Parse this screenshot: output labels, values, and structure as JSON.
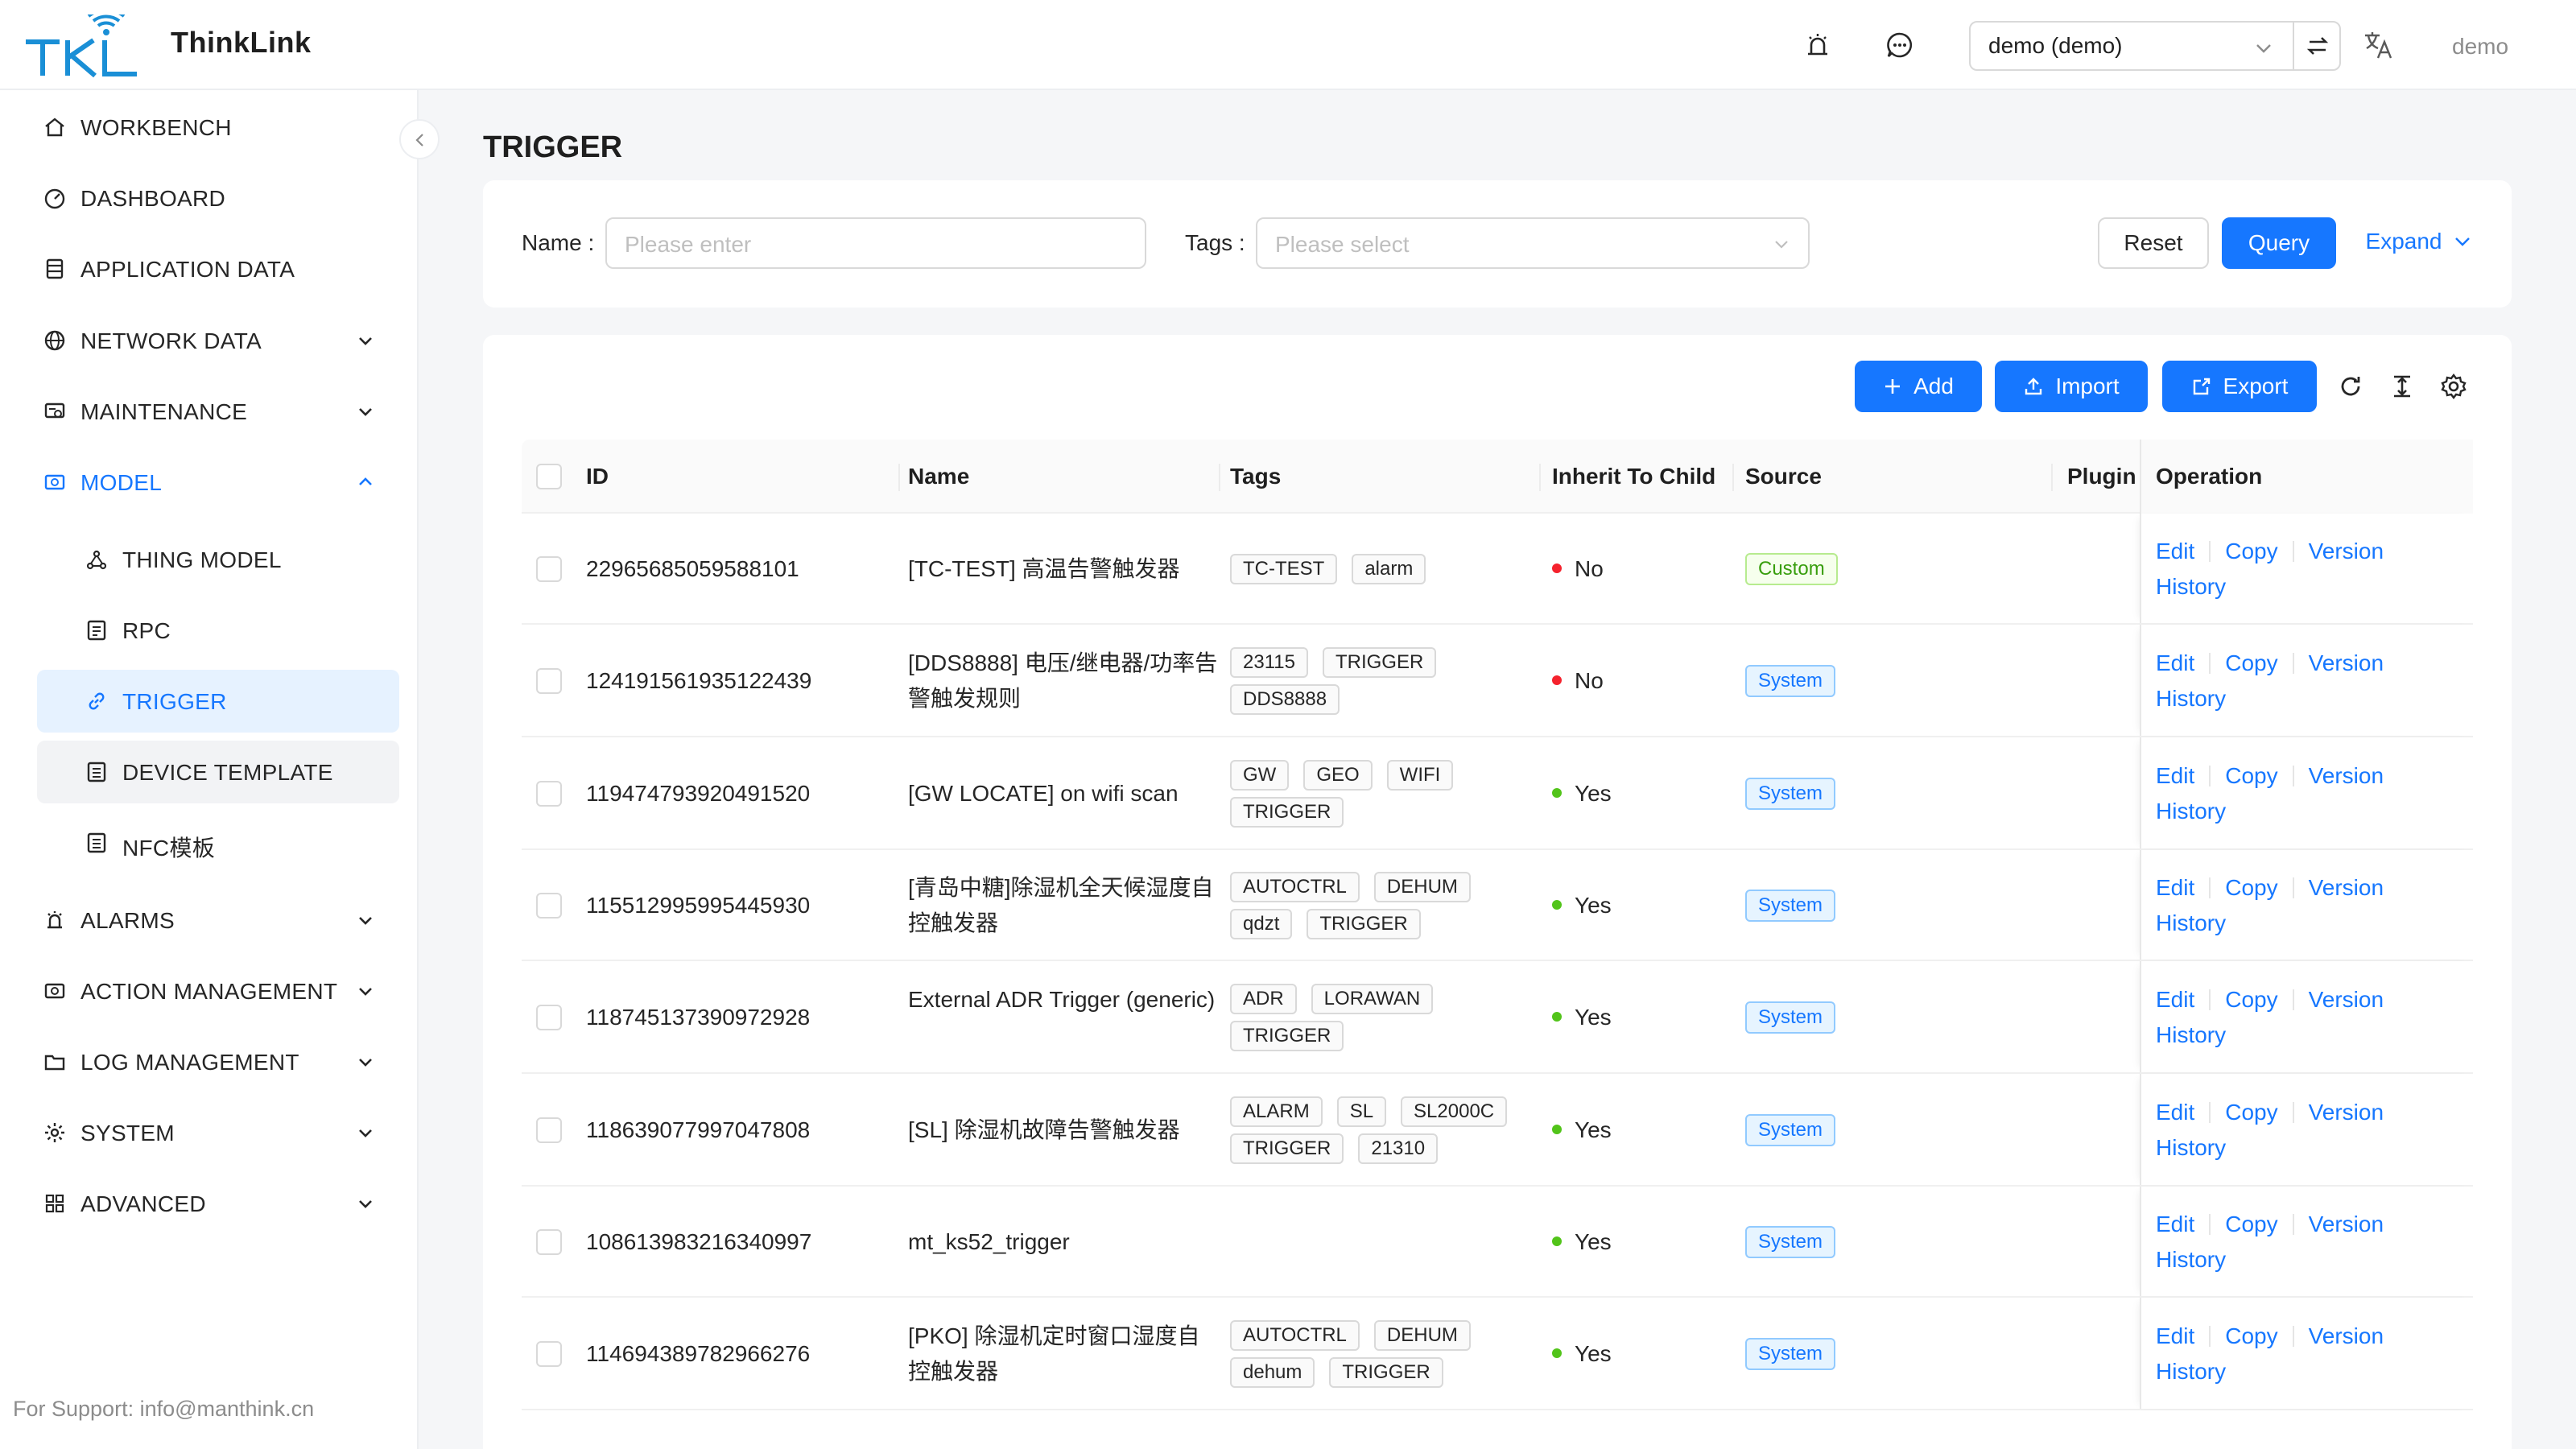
{
  "app": {
    "brand": "ThinkLink",
    "tenant_value": "demo (demo)",
    "user": "demo",
    "support": "For Support: info@manthink.cn"
  },
  "sidebar": {
    "items": [
      {
        "label": "WORKBENCH",
        "icon": "home-icon"
      },
      {
        "label": "DASHBOARD",
        "icon": "dashboard-icon"
      },
      {
        "label": "APPLICATION DATA",
        "icon": "database-icon"
      },
      {
        "label": "NETWORK DATA",
        "icon": "globe-icon"
      },
      {
        "label": "MAINTENANCE",
        "icon": "maintenance-icon"
      },
      {
        "label": "MODEL",
        "icon": "model-icon"
      },
      {
        "label": "THING MODEL",
        "icon": "nodes-icon"
      },
      {
        "label": "RPC",
        "icon": "rpc-icon"
      },
      {
        "label": "TRIGGER",
        "icon": "link-icon"
      },
      {
        "label": "DEVICE TEMPLATE",
        "icon": "template-icon"
      },
      {
        "label": "NFC模板",
        "icon": "nfc-icon"
      },
      {
        "label": "ALARMS",
        "icon": "alarm-icon"
      },
      {
        "label": "ACTION MANAGEMENT",
        "icon": "action-icon"
      },
      {
        "label": "LOG MANAGEMENT",
        "icon": "folder-icon"
      },
      {
        "label": "SYSTEM",
        "icon": "gear-icon"
      },
      {
        "label": "ADVANCED",
        "icon": "grid-icon"
      }
    ]
  },
  "page": {
    "title": "TRIGGER"
  },
  "search": {
    "name_label": "Name",
    "name_placeholder": "Please enter",
    "tags_label": "Tags",
    "tags_placeholder": "Please select",
    "reset_label": "Reset",
    "query_label": "Query",
    "expand_label": "Expand"
  },
  "toolbar": {
    "add_label": "Add",
    "import_label": "Import",
    "export_label": "Export"
  },
  "table": {
    "columns": [
      "ID",
      "Name",
      "Tags",
      "Inherit To Child",
      "Source",
      "Plugin",
      "Operation"
    ],
    "op_edit": "Edit",
    "op_copy": "Copy",
    "op_version": "Version",
    "op_history": "History",
    "rows": [
      {
        "id": "22965685059588101",
        "name": "[TC-TEST] 高温告警触发器",
        "tags": [
          "TC-TEST",
          "alarm"
        ],
        "inherit": "No",
        "source": "Custom"
      },
      {
        "id": "124191561935122439",
        "name": "[DDS8888] 电压/继电器/功率告警触发规则",
        "tags": [
          "23115",
          "TRIGGER",
          "DDS8888"
        ],
        "inherit": "No",
        "source": "System"
      },
      {
        "id": "119474793920491520",
        "name": "[GW LOCATE] on wifi scan",
        "tags": [
          "GW",
          "GEO",
          "WIFI",
          "TRIGGER"
        ],
        "inherit": "Yes",
        "source": "System"
      },
      {
        "id": "115512995995445930",
        "name": "[青岛中糖]除湿机全天候湿度自控触发器",
        "tags": [
          "AUTOCTRL",
          "DEHUM",
          "qdzt",
          "TRIGGER"
        ],
        "inherit": "Yes",
        "source": "System"
      },
      {
        "id": "118745137390972928",
        "name": "External ADR Trigger (generic)",
        "tags": [
          "ADR",
          "LORAWAN",
          "TRIGGER"
        ],
        "inherit": "Yes",
        "source": "System"
      },
      {
        "id": "118639077997047808",
        "name": "[SL] 除湿机故障告警触发器",
        "tags": [
          "ALARM",
          "SL",
          "SL2000C",
          "TRIGGER",
          "21310"
        ],
        "inherit": "Yes",
        "source": "System"
      },
      {
        "id": "108613983216340997",
        "name": "mt_ks52_trigger",
        "tags": [],
        "inherit": "Yes",
        "source": "System"
      },
      {
        "id": "114694389782966276",
        "name": "[PKO] 除湿机定时窗口湿度自控触发器",
        "tags": [
          "AUTOCTRL",
          "DEHUM",
          "dehum",
          "TRIGGER"
        ],
        "inherit": "Yes",
        "source": "System"
      }
    ]
  },
  "colors": {
    "primary": "#1677ff",
    "status_no": "#f5222d",
    "status_yes": "#52c41a"
  }
}
